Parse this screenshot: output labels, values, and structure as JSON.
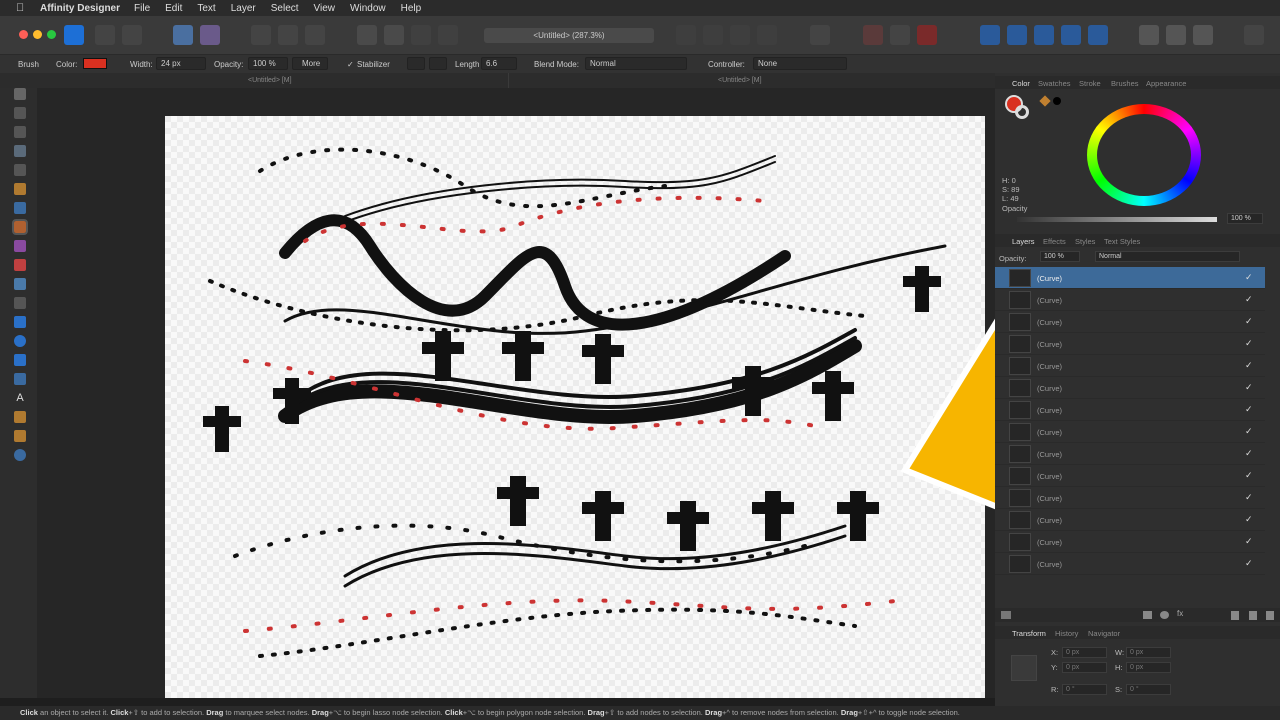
{
  "menubar": {
    "app_name": "Affinity Designer",
    "items": [
      "File",
      "Edit",
      "Text",
      "Layer",
      "Select",
      "View",
      "Window",
      "Help"
    ]
  },
  "document": {
    "title": "<Untitled> (287.3%)",
    "tab_left": "<Untitled> [M]",
    "tab_right": "<Untitled> [M]"
  },
  "context_toolbar": {
    "tool": "Brush",
    "color_label": "Color:",
    "color": "#d93020",
    "width_label": "Width:",
    "width_value": "24 px",
    "opacity_label": "Opacity:",
    "opacity_value": "100 %",
    "more_label": "More",
    "stabilizer_label": "Stabilizer",
    "length_label": "Length",
    "length_value": "6.6",
    "blend_label": "Blend Mode:",
    "blend_value": "Normal",
    "controller_label": "Controller:",
    "controller_value": "None"
  },
  "color_panel": {
    "tabs": [
      "Color",
      "Swatches",
      "Stroke",
      "Brushes",
      "Appearance"
    ],
    "h": "H: 0",
    "s": "S: 89",
    "l": "L: 49",
    "opacity_label": "Opacity",
    "opacity_value": "100 %"
  },
  "layers_panel": {
    "tabs": [
      "Layers",
      "Effects",
      "Styles",
      "Text Styles"
    ],
    "opacity_label": "Opacity:",
    "opacity_value": "100 %",
    "blend_value": "Normal",
    "layers": [
      "(Curve)",
      "(Curve)",
      "(Curve)",
      "(Curve)",
      "(Curve)",
      "(Curve)",
      "(Curve)",
      "(Curve)",
      "(Curve)",
      "(Curve)",
      "(Curve)",
      "(Curve)",
      "(Curve)",
      "(Curve)"
    ],
    "check": "✓"
  },
  "transform_panel": {
    "tabs": [
      "Transform",
      "History",
      "Navigator"
    ],
    "x_label": "X:",
    "x_value": "0 px",
    "y_label": "Y:",
    "y_value": "0 px",
    "w_label": "W:",
    "w_value": "0 px",
    "h_label": "H:",
    "h_value": "0 px",
    "r_label": "R:",
    "r_value": "0 °",
    "s_label": "S:",
    "s_value": "0 °"
  },
  "status": [
    {
      "b": "Click",
      "t": " an object to select it. "
    },
    {
      "b": "Click",
      "t": "+⇧ to add to selection. "
    },
    {
      "b": "Drag",
      "t": " to marquee select nodes. "
    },
    {
      "b": "Drag",
      "t": "+⌥ to begin lasso node selection. "
    },
    {
      "b": "Click",
      "t": "+⌥ to begin polygon node selection. "
    },
    {
      "b": "Drag",
      "t": "+⇧ to add nodes to selection. "
    },
    {
      "b": "Drag",
      "t": "+^ to remove nodes from selection. "
    },
    {
      "b": "Drag",
      "t": "+⇧+^ to toggle node selection."
    }
  ],
  "colors": {
    "accent_red": "#d93020",
    "arrow_yellow": "#f7b500",
    "selection_blue": "#3d6a99"
  }
}
